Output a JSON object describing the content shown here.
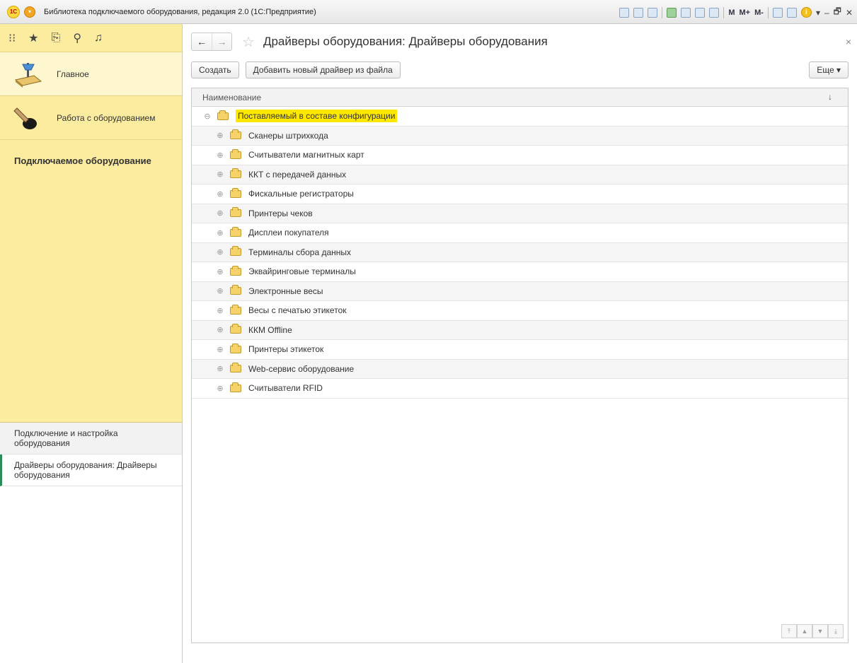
{
  "window": {
    "title": "Библиотека подключаемого оборудования, редакция 2.0  (1С:Предприятие)",
    "logo_text": "1С",
    "toolbar_m": [
      "M",
      "M+",
      "M-"
    ],
    "info_icon_label": "i"
  },
  "sidebar": {
    "top_icons": [
      "apps-grid-icon",
      "star-icon",
      "history-icon",
      "search-icon",
      "bell-icon"
    ],
    "sections": [
      {
        "label": "Главное",
        "icon": "home-desk-icon"
      },
      {
        "label": "Работа с оборудованием",
        "icon": "pen-icon"
      }
    ],
    "panel_heading": "Подключаемое оборудование",
    "open_windows": [
      {
        "label": "Подключение и настройка оборудования",
        "current": false
      },
      {
        "label": "Драйверы оборудования: Драйверы оборудования",
        "current": true
      }
    ]
  },
  "main": {
    "title": "Драйверы оборудования: Драйверы оборудования",
    "buttons": {
      "create": "Создать",
      "add_from_file": "Добавить новый драйвер из файла",
      "more": "Еще ▾"
    },
    "table": {
      "column": "Наименование",
      "sort_symbol": "↓",
      "root": "Поставляемый в составе конфигурации",
      "rows": [
        "Сканеры штрихкода",
        "Считыватели магнитных карт",
        "ККТ с передачей данных",
        "Фискальные регистраторы",
        "Принтеры чеков",
        "Дисплеи покупателя",
        "Терминалы сбора данных",
        "Эквайринговые терминалы",
        "Электронные весы",
        "Весы с печатью этикеток",
        "ККМ Offline",
        "Принтеры этикеток",
        "Web-сервис оборудование",
        "Считыватели RFID"
      ]
    }
  }
}
